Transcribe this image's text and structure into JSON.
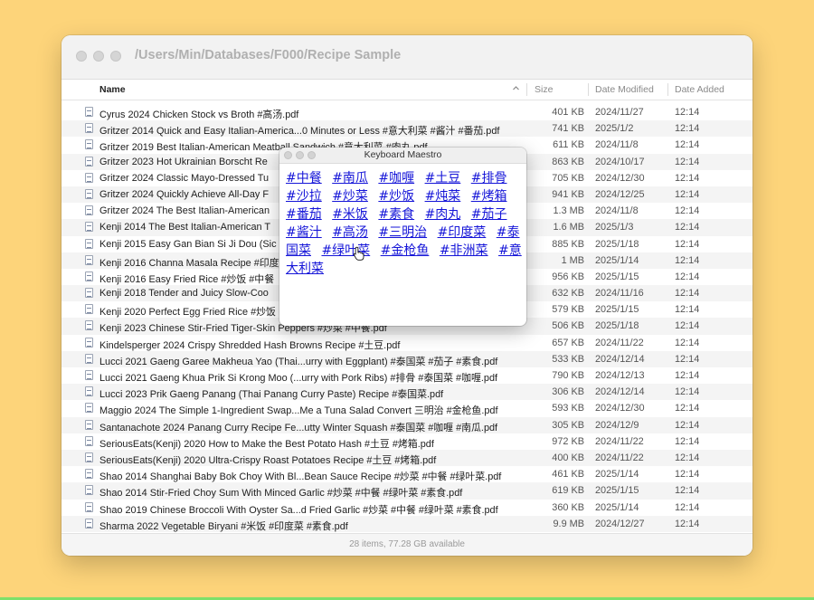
{
  "window": {
    "title": "/Users/Min/Databases/F000/Recipe Sample",
    "columns": {
      "name": "Name",
      "size": "Size",
      "date_modified": "Date Modified",
      "date_added": "Date Added"
    },
    "status": "28 items, 77.28 GB available"
  },
  "files": [
    {
      "name": "Cyrus 2024 Chicken Stock vs Broth #高汤.pdf",
      "size": "401 KB",
      "modified": "2024/11/27",
      "added": "12:14"
    },
    {
      "name": "Gritzer 2014 Quick and Easy Italian-America...0 Minutes or Less #意大利菜 #酱汁 #番茄.pdf",
      "size": "741 KB",
      "modified": "2025/1/2",
      "added": "12:14"
    },
    {
      "name": "Gritzer 2019 Best Italian-American Meatball Sandwich #意大利菜 #肉丸.pdf",
      "size": "611 KB",
      "modified": "2024/11/8",
      "added": "12:14"
    },
    {
      "name": "Gritzer 2023 Hot Ukrainian Borscht Re",
      "size": "863 KB",
      "modified": "2024/10/17",
      "added": "12:14"
    },
    {
      "name": "Gritzer 2024 Classic Mayo-Dressed Tu",
      "size": "705 KB",
      "modified": "2024/12/30",
      "added": "12:14"
    },
    {
      "name": "Gritzer 2024 Quickly Achieve All-Day F",
      "size": "941 KB",
      "modified": "2024/12/25",
      "added": "12:14"
    },
    {
      "name": "Gritzer 2024 The Best Italian-American",
      "size": "1.3 MB",
      "modified": "2024/11/8",
      "added": "12:14"
    },
    {
      "name": "Kenji 2014 The Best Italian-American T",
      "size": "1.6 MB",
      "modified": "2025/1/3",
      "added": "12:14"
    },
    {
      "name": "Kenji 2015 Easy Gan Bian Si Ji Dou (Sic",
      "size": "885 KB",
      "modified": "2025/1/18",
      "added": "12:14"
    },
    {
      "name": "Kenji 2016 Channa Masala Recipe #印度",
      "size": "1 MB",
      "modified": "2025/1/14",
      "added": "12:14"
    },
    {
      "name": "Kenji 2016 Easy Fried Rice #炒饭 #中餐",
      "size": "956 KB",
      "modified": "2025/1/15",
      "added": "12:14"
    },
    {
      "name": "Kenji 2018 Tender and Juicy Slow-Coo",
      "size": "632 KB",
      "modified": "2024/11/16",
      "added": "12:14"
    },
    {
      "name": "Kenji 2020 Perfect Egg Fried Rice #炒饭",
      "size": "579 KB",
      "modified": "2025/1/15",
      "added": "12:14"
    },
    {
      "name": "Kenji 2023 Chinese Stir-Fried Tiger-Skin Peppers #炒菜 #中餐.pdf",
      "size": "506 KB",
      "modified": "2025/1/18",
      "added": "12:14"
    },
    {
      "name": "Kindelsperger 2024 Crispy Shredded Hash Browns Recipe #土豆.pdf",
      "size": "657 KB",
      "modified": "2024/11/22",
      "added": "12:14"
    },
    {
      "name": "Lucci 2021 Gaeng Garee Makheua Yao (Thai...urry with Eggplant) #泰国菜 #茄子 #素食.pdf",
      "size": "533 KB",
      "modified": "2024/12/14",
      "added": "12:14"
    },
    {
      "name": "Lucci 2021 Gaeng Khua Prik Si Krong Moo (...urry with Pork Ribs) #排骨 #泰国菜 #咖喱.pdf",
      "size": "790 KB",
      "modified": "2024/12/13",
      "added": "12:14"
    },
    {
      "name": "Lucci 2023 Prik Gaeng Panang (Thai Panang Curry Paste) Recipe #泰国菜.pdf",
      "size": "306 KB",
      "modified": "2024/12/14",
      "added": "12:14"
    },
    {
      "name": "Maggio 2024 The Simple 1-Ingredient Swap...Me a Tuna Salad Convert 三明治 #金枪鱼.pdf",
      "size": "593 KB",
      "modified": "2024/12/30",
      "added": "12:14"
    },
    {
      "name": "Santanachote 2024 Panang Curry Recipe Fe...utty Winter Squash #泰国菜 #咖喱 #南瓜.pdf",
      "size": "305 KB",
      "modified": "2024/12/9",
      "added": "12:14"
    },
    {
      "name": "SeriousEats(Kenji) 2020 How to Make the Best Potato Hash #土豆 #烤箱.pdf",
      "size": "972 KB",
      "modified": "2024/11/22",
      "added": "12:14"
    },
    {
      "name": "SeriousEats(Kenji) 2020 Ultra-Crispy Roast Potatoes Recipe #土豆 #烤箱.pdf",
      "size": "400 KB",
      "modified": "2024/11/22",
      "added": "12:14"
    },
    {
      "name": "Shao 2014 Shanghai Baby Bok Choy With Bl...Bean Sauce Recipe #炒菜 #中餐 #绿叶菜.pdf",
      "size": "461 KB",
      "modified": "2025/1/14",
      "added": "12:14"
    },
    {
      "name": "Shao 2014 Stir-Fried Choy Sum With Minced Garlic #炒菜 #中餐 #绿叶菜 #素食.pdf",
      "size": "619 KB",
      "modified": "2025/1/15",
      "added": "12:14"
    },
    {
      "name": "Shao 2019 Chinese Broccoli With Oyster Sa...d Fried Garlic #炒菜 #中餐 #绿叶菜 #素食.pdf",
      "size": "360 KB",
      "modified": "2025/1/14",
      "added": "12:14"
    },
    {
      "name": "Sharma 2022 Vegetable Biryani #米饭 #印度菜 #素食.pdf",
      "size": "9.9 MB",
      "modified": "2024/12/27",
      "added": "12:14"
    }
  ],
  "palette": {
    "title": "Keyboard Maestro",
    "tags": [
      "#中餐",
      "#南瓜",
      "#咖喱",
      "#土豆",
      "#排骨",
      "#沙拉",
      "#炒菜",
      "#炒饭",
      "#炖菜",
      "#烤箱",
      "#番茄",
      "#米饭",
      "#素食",
      "#肉丸",
      "#茄子",
      "#酱汁",
      "#高汤",
      "#三明治",
      "#印度菜",
      "#泰国菜",
      "#绿叶菜",
      "#金枪鱼",
      "#非洲菜",
      "#意大利菜"
    ]
  },
  "colors": {
    "desktop": "#fdd47a",
    "tag_link": "#1515d8"
  },
  "icons": [
    "doc-icon",
    "sort-ascending-icon",
    "pointer-cursor-icon"
  ]
}
